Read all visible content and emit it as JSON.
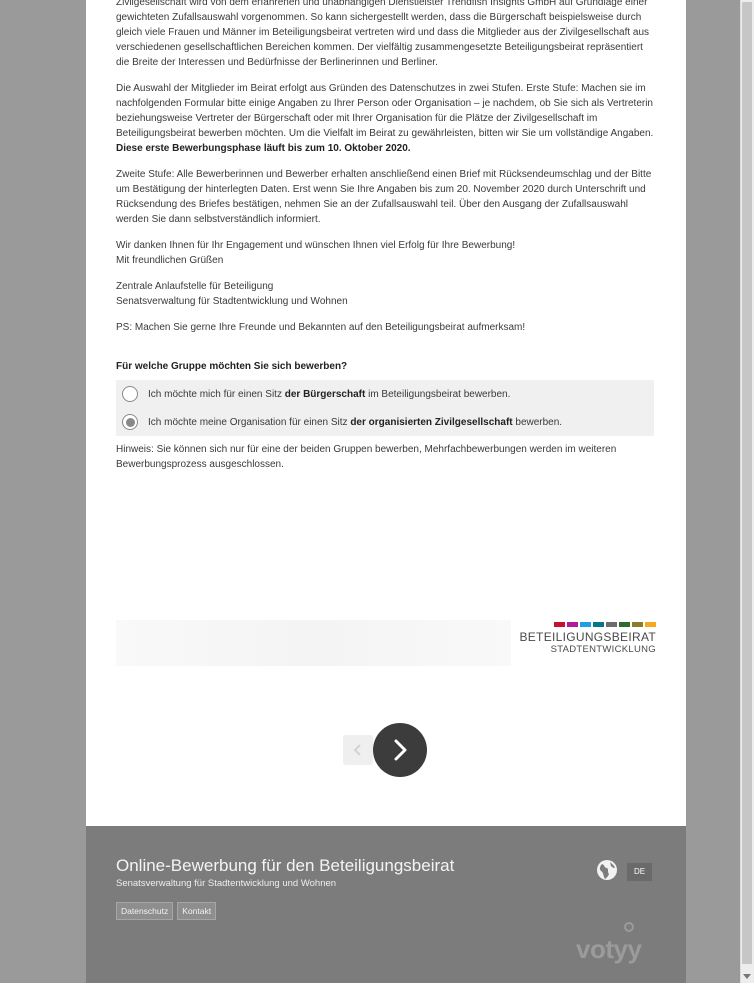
{
  "intro": {
    "p1_line1": "Zivilgesellschaft wird von dem erfahrenen und unabhängigen Dienstleister Trendfish Insights GmbH auf",
    "p1_rest": "Grundlage einer gewichteten Zufallsauswahl vorgenommen. So kann sichergestellt werden, dass die Bürgerschaft beispielsweise durch gleich viele Frauen und Männer im Beteiligungsbeirat vertreten wird und dass die Mitglieder aus der Zivilgesellschaft aus verschiedenen gesellschaftlichen Bereichen kommen. Der vielfältig zusammengesetzte Beteiligungsbeirat repräsentiert die Breite der Interessen und Bedürfnisse der Berlinerinnen und Berliner.",
    "p2_text": "Die Auswahl der Mitglieder im Beirat erfolgt aus Gründen des Datenschutzes in zwei Stufen. Erste Stufe: Machen sie im nachfolgenden Formular bitte einige Angaben zu Ihrer Person oder Organisation – je nachdem, ob Sie sich als Vertreterin beziehungsweise Vertreter der Bürgerschaft oder mit Ihrer Organisation für die Plätze der Zivilgesellschaft im Beteiligungsbeirat bewerben möchten. Um die Vielfalt im Beirat zu gewährleisten, bitten wir Sie um vollständige Angaben.",
    "p2_bold": "Diese erste Bewerbungsphase läuft bis zum 10. Oktober 2020.",
    "p3": "Zweite Stufe: Alle Bewerberinnen und Bewerber erhalten anschließend einen Brief mit Rücksendeumschlag und der Bitte um Bestätigung der hinterlegten Daten. Erst wenn Sie Ihre Angaben bis zum 20. November 2020 durch Unterschrift und Rücksendung des Briefes bestätigen, nehmen Sie an der Zufallsauswahl teil. Über den Ausgang der Zufallsauswahl werden Sie dann selbstverständlich informiert.",
    "p4_line1": "Wir danken Ihnen für Ihr Engagement und wünschen Ihnen viel Erfolg für Ihre Bewerbung!",
    "p4_line2": "Mit freundlichen Grüßen",
    "p5_line1": "Zentrale Anlaufstelle für Beteiligung",
    "p5_line2": "Senatsverwaltung für Stadtentwicklung und Wohnen",
    "ps": "PS: Machen Sie gerne Ihre Freunde und Bekannten auf den Beteiligungsbeirat aufmerksam!"
  },
  "form": {
    "question": "Für welche Gruppe möchten Sie sich bewerben?",
    "option1_pre": "Ich möchte mich für einen Sitz ",
    "option1_bold": "der Bürgerschaft",
    "option1_post": " im Beteiligungsbeirat bewerben.",
    "option2_pre": "Ich möchte meine Organisation für einen Sitz ",
    "option2_bold": "der organisierten Zivilgesellschaft",
    "option2_post": " bewerben.",
    "selected_option": 2,
    "hint": "Hinweis: Sie können sich nur für eine der beiden Gruppen bewerben, Mehrfachbewerbungen werden im weiteren Bewerbungsprozess ausgeschlossen."
  },
  "brand": {
    "name": "BETEILIGUNGSBEIRAT",
    "sub": "STADTENTWICKLUNG",
    "bar_colors": [
      "#c8102e",
      "#b5179e",
      "#1ba1e2",
      "#00788a",
      "#6d6d6d",
      "#2f6b2f",
      "#8a7d2a",
      "#f7a823"
    ]
  },
  "nav": {
    "prev_icon": "chevron-left-icon",
    "next_icon": "chevron-right-icon"
  },
  "footer": {
    "title": "Online-Bewerbung für den Beteiligungsbeirat",
    "subtitle": "Senatsverwaltung für Stadtentwicklung und Wohnen",
    "link_privacy": "Datenschutz",
    "link_contact": "Kontakt",
    "language": "DE",
    "logo": "votyy"
  }
}
